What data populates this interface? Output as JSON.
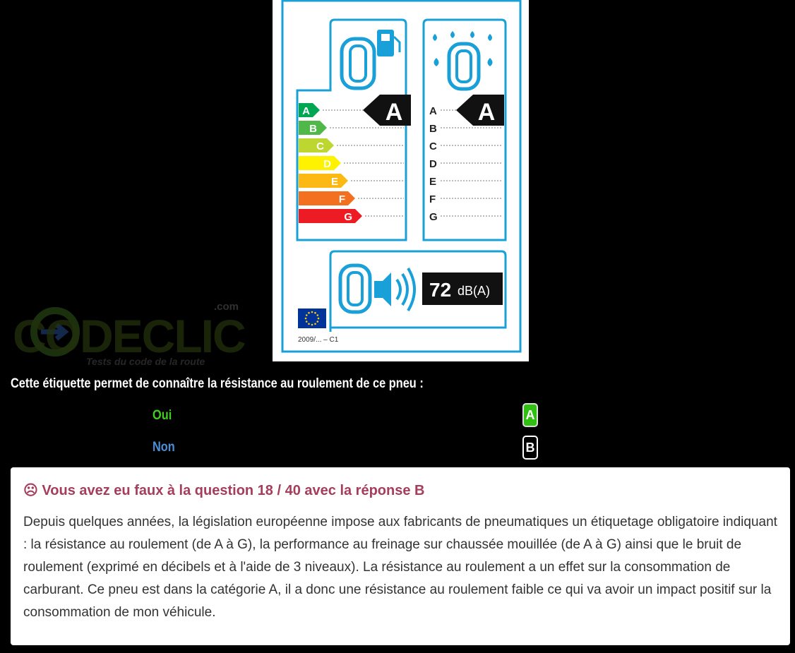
{
  "tire_label": {
    "fuel_grades": [
      "A",
      "B",
      "C",
      "D",
      "E",
      "F",
      "G"
    ],
    "wet_grades": [
      "A",
      "B",
      "C",
      "D",
      "E",
      "F",
      "G"
    ],
    "fuel_rating": "A",
    "wet_rating": "A",
    "noise_value": "72",
    "noise_unit": "dB(A)",
    "regulation": "2009/... – C1",
    "grade_colors": [
      "#00a651",
      "#50b848",
      "#bed630",
      "#fff200",
      "#fdb913",
      "#f37021",
      "#ed1c24"
    ],
    "frame_color": "#1aa0d8"
  },
  "watermark": {
    "brand": "CODECLIC",
    "domain": ".com",
    "tagline": "Tests du code de la route"
  },
  "question": {
    "text": "Cette étiquette permet de connaître la résistance au roulement de ce pneu :",
    "answers": [
      {
        "label": "Oui",
        "key": "A"
      },
      {
        "label": "Non",
        "key": "B"
      }
    ]
  },
  "feedback": {
    "title": "☹ Vous avez eu faux à la question 18 / 40 avec la réponse B",
    "explanation": "Depuis quelques années, la législation européenne impose aux fabricants de pneumatiques un étiquetage obligatoire indiquant : la résistance au roulement (de A à G), la performance au freinage sur chaussée mouillée (de A à G) ainsi que le bruit de roulement (exprimé en décibels et à l'aide de 3 niveaux). La résistance au roulement a un effet sur la consommation de carburant. Ce pneu est dans la catégorie A, il a donc une résistance au roulement faible ce qui va avoir un impact positif sur la consommation de mon véhicule."
  }
}
